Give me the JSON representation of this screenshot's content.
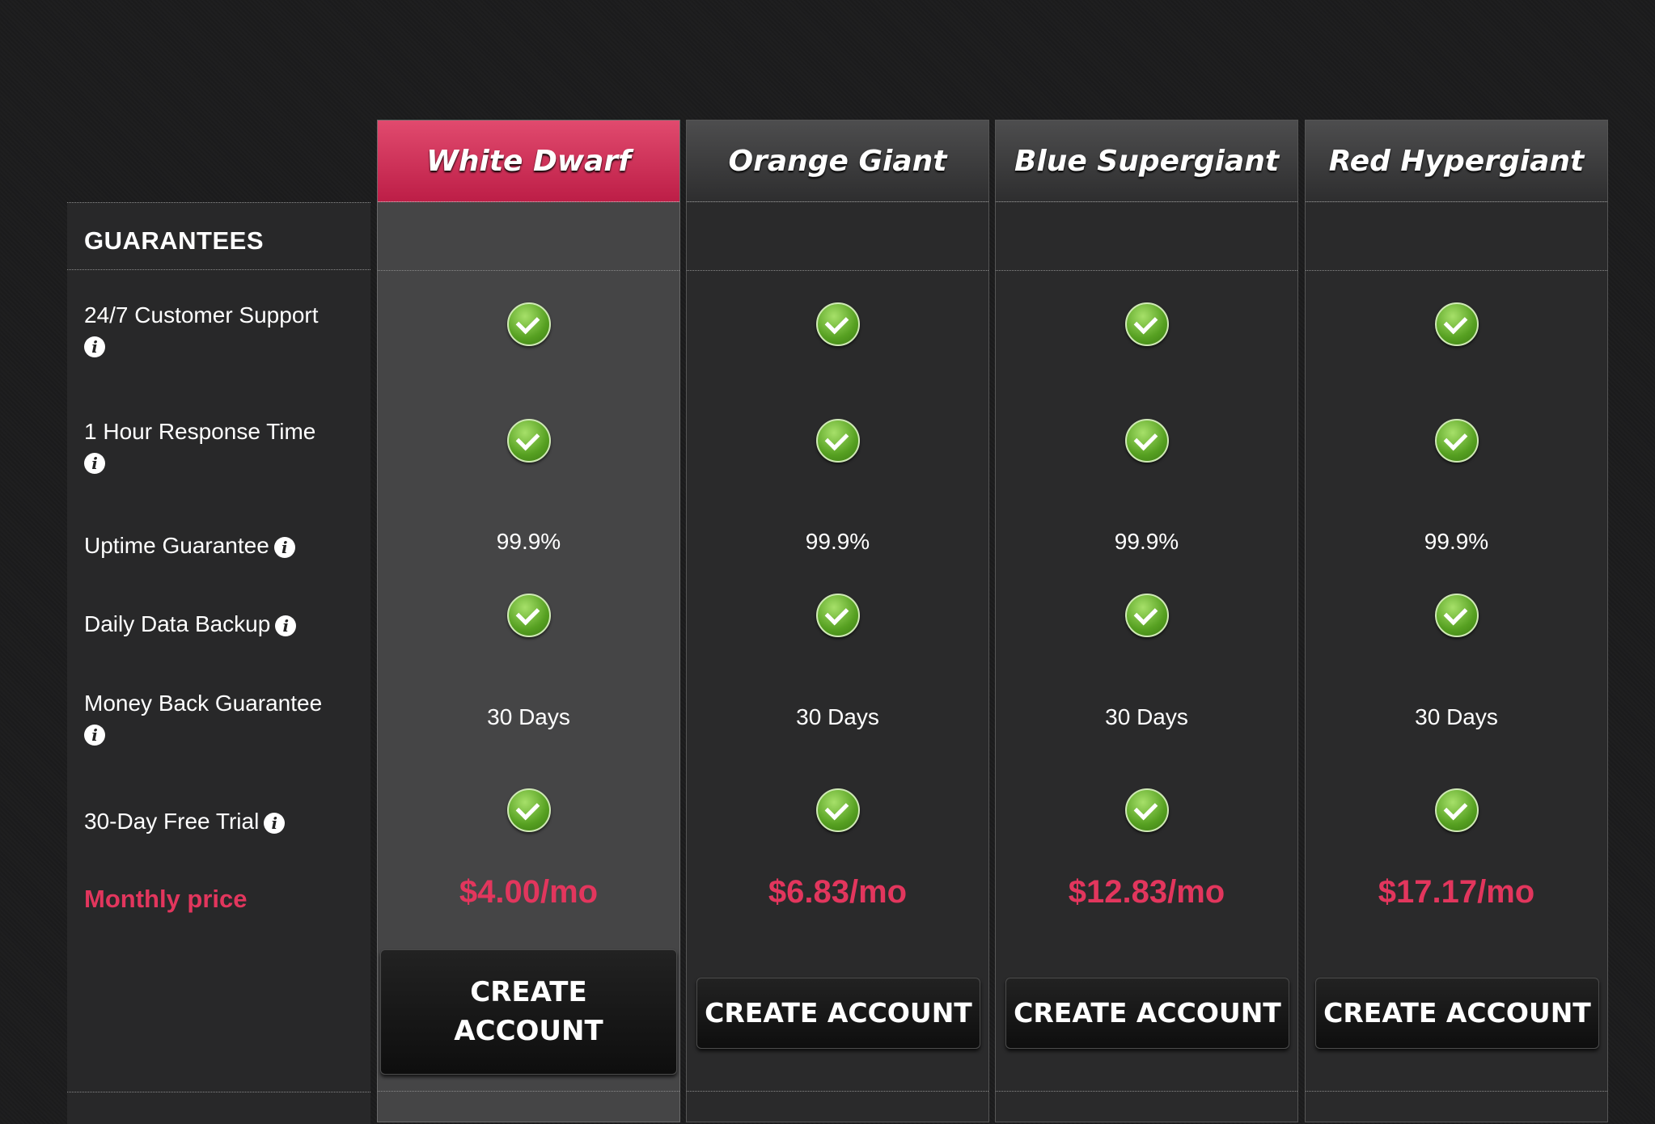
{
  "section": {
    "title": "GUARANTEES"
  },
  "features": [
    {
      "label": "24/7 Customer Support"
    },
    {
      "label": "1 Hour Response Time"
    },
    {
      "label": "Uptime Guarantee"
    },
    {
      "label": "Daily Data Backup"
    },
    {
      "label": "Money Back Guarantee"
    },
    {
      "label": "30-Day Free Trial"
    }
  ],
  "info_icon": "i",
  "monthly_label": "Monthly price",
  "plans": [
    {
      "name": "White Dwarf",
      "uptime": "99.9%",
      "money_back": "30 Days",
      "price": "$4.00/mo",
      "cta": "CREATE ACCOUNT",
      "featured": true
    },
    {
      "name": "Orange Giant",
      "uptime": "99.9%",
      "money_back": "30 Days",
      "price": "$6.83/mo",
      "cta": "CREATE ACCOUNT",
      "featured": false
    },
    {
      "name": "Blue Supergiant",
      "uptime": "99.9%",
      "money_back": "30 Days",
      "price": "$12.83/mo",
      "cta": "CREATE ACCOUNT",
      "featured": false
    },
    {
      "name": "Red Hypergiant",
      "uptime": "99.9%",
      "money_back": "30 Days",
      "price": "$17.17/mo",
      "cta": "CREATE ACCOUNT",
      "featured": false
    }
  ],
  "colors": {
    "accent": "#e2365d",
    "featured_header": "#c9284f",
    "check": "#6db52e"
  }
}
